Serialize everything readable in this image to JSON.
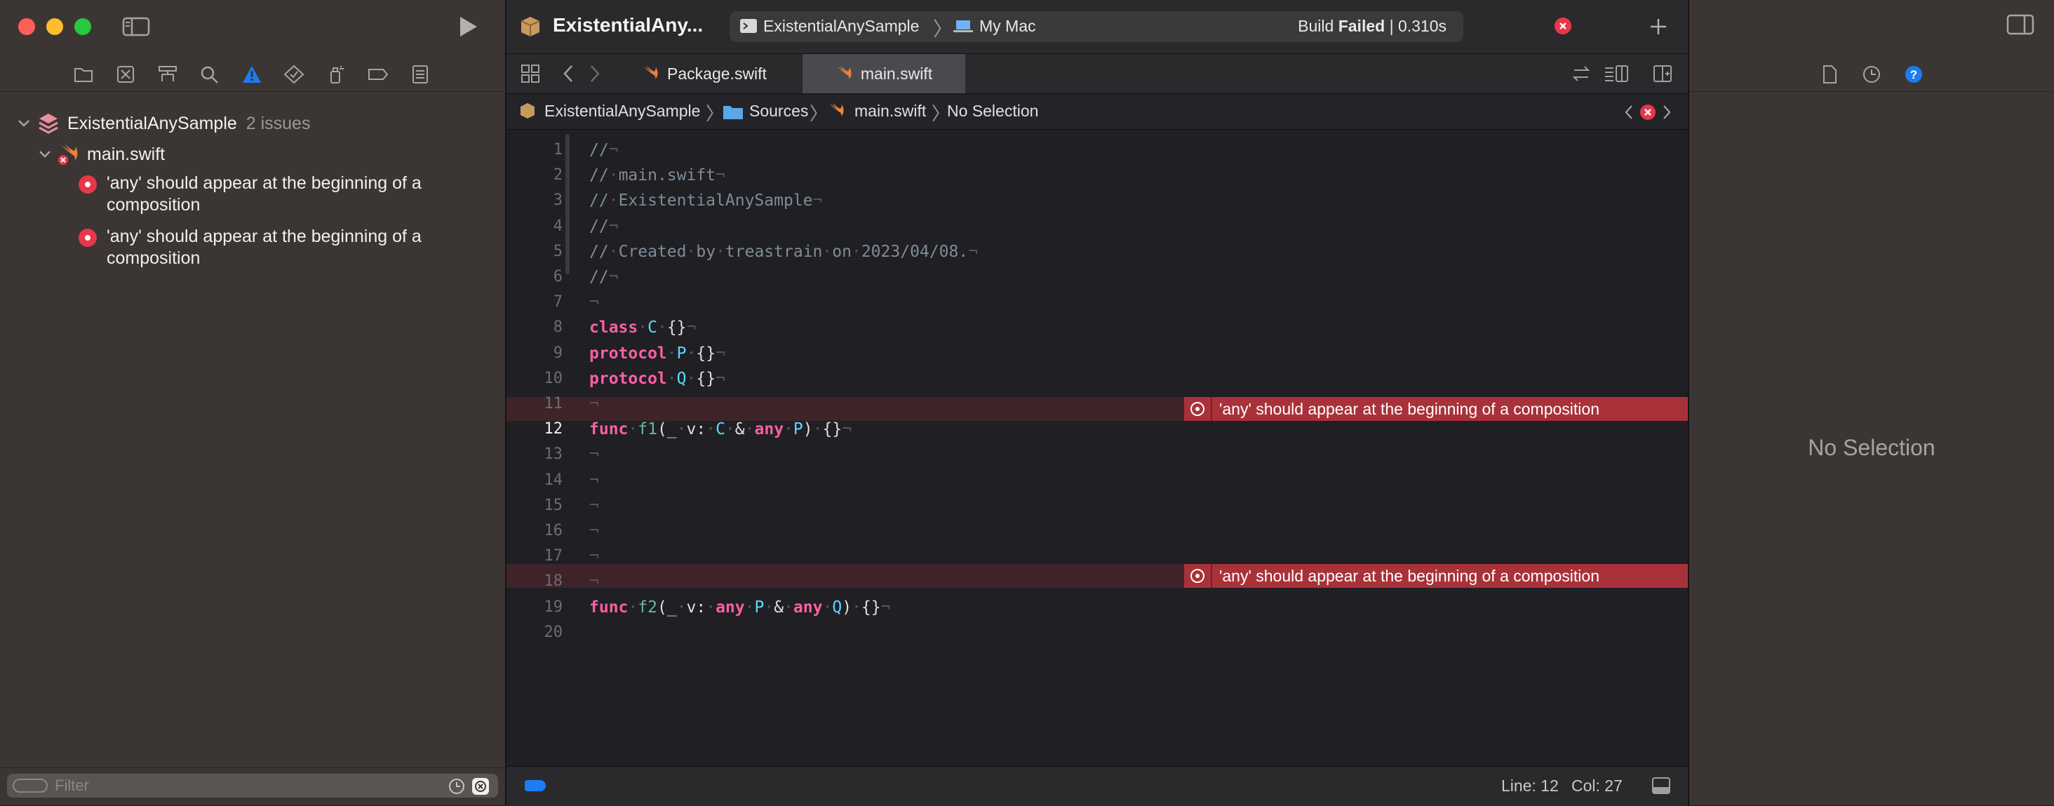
{
  "window": {
    "project_title": "ExistentialAny...",
    "scheme_name": "ExistentialAnySample",
    "destination": "My Mac",
    "build_status_prefix": "Build ",
    "build_status_state": "Failed",
    "build_status_time": " | 0.310s"
  },
  "navigator": {
    "project": {
      "name": "ExistentialAnySample",
      "issue_count": "2 issues",
      "file": {
        "name": "main.swift",
        "issues": [
          {
            "line1": "'any' should appear at the beginning of a",
            "line2": "composition"
          },
          {
            "line1": "'any' should appear at the beginning of a",
            "line2": "composition"
          }
        ]
      }
    },
    "filter_placeholder": "Filter"
  },
  "tabs": [
    {
      "label": "Package.swift",
      "active": false
    },
    {
      "label": "main.swift",
      "active": true
    }
  ],
  "jumpbar": {
    "crumbs": [
      "ExistentialAnySample",
      "Sources",
      "main.swift",
      "No Selection"
    ]
  },
  "editor": {
    "lines": [
      {
        "n": "1",
        "t": "//"
      },
      {
        "n": "2",
        "t": "// main.swift"
      },
      {
        "n": "3",
        "t": "// ExistentialAnySample"
      },
      {
        "n": "4",
        "t": "//"
      },
      {
        "n": "5",
        "t": "// Created by treastrain on 2023/04/08."
      },
      {
        "n": "6",
        "t": "//"
      },
      {
        "n": "7",
        "t": ""
      },
      {
        "n": "8",
        "t": "class C {}"
      },
      {
        "n": "9",
        "t": "protocol P {}"
      },
      {
        "n": "10",
        "t": "protocol Q {}"
      },
      {
        "n": "11",
        "t": ""
      },
      {
        "n": "12",
        "t": "func f1(_ v: C & any P) {}"
      },
      {
        "n": "13",
        "t": ""
      },
      {
        "n": "14",
        "t": ""
      },
      {
        "n": "15",
        "t": ""
      },
      {
        "n": "16",
        "t": ""
      },
      {
        "n": "17",
        "t": ""
      },
      {
        "n": "18",
        "t": ""
      },
      {
        "n": "19",
        "t": "func f2(_ v: any P & any Q) {}"
      },
      {
        "n": "20",
        "t": ""
      }
    ],
    "error_message": "'any' should appear at the beginning of a composition",
    "current_line": "12"
  },
  "status": {
    "line_label": "Line: 12",
    "col_label": "Col: 27"
  },
  "inspector": {
    "empty_label": "No Selection"
  },
  "colors": {
    "error": "#e8364a",
    "keyword": "#fc5fa3",
    "type": "#5dd8ff",
    "accent": "#1d7cf2"
  }
}
